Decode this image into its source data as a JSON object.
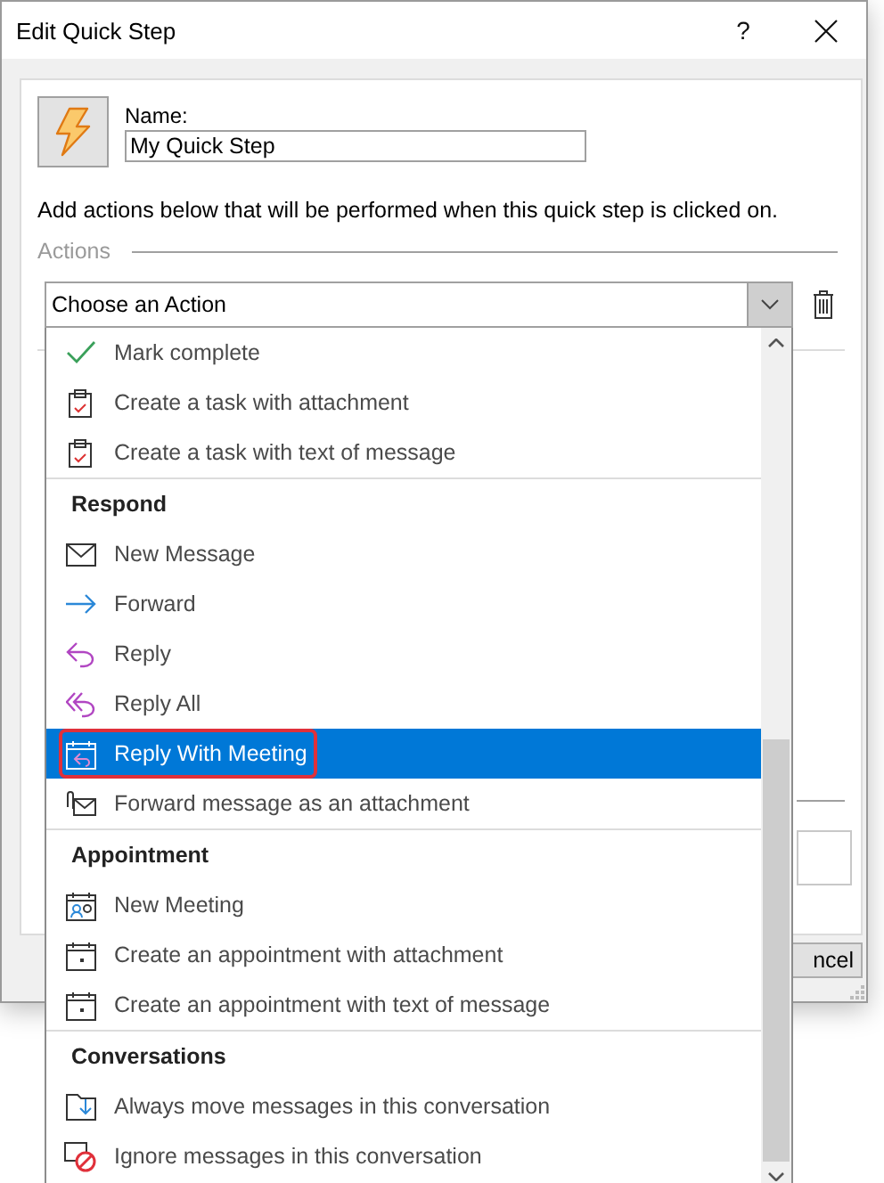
{
  "window": {
    "title": "Edit Quick Step",
    "help": "?"
  },
  "name_field": {
    "label": "Name:",
    "value": "My Quick Step"
  },
  "description": "Add actions below that will be performed when this quick step is clicked on.",
  "actions_heading": "Actions",
  "action_select": {
    "value": "Choose an Action",
    "expanded": true
  },
  "cancel_button": "ncel",
  "menu": {
    "groups": [
      {
        "items": [
          {
            "label": "Mark complete",
            "kind": "check",
            "selected": false
          },
          {
            "label": "Create a task with attachment",
            "kind": "task",
            "selected": false
          },
          {
            "label": "Create a task with text of message",
            "kind": "task",
            "selected": false
          }
        ]
      },
      {
        "heading": "Respond",
        "items": [
          {
            "label": "New Message",
            "kind": "mail",
            "selected": false
          },
          {
            "label": "Forward",
            "kind": "forward",
            "selected": false
          },
          {
            "label": "Reply",
            "kind": "reply",
            "selected": false
          },
          {
            "label": "Reply All",
            "kind": "reply-all",
            "selected": false
          },
          {
            "label": "Reply With Meeting",
            "kind": "meeting-reply",
            "selected": true
          },
          {
            "label": "Forward message as an attachment",
            "kind": "attach",
            "selected": false
          }
        ]
      },
      {
        "heading": "Appointment",
        "items": [
          {
            "label": "New Meeting",
            "kind": "meeting",
            "selected": false
          },
          {
            "label": "Create an appointment with attachment",
            "kind": "appointment",
            "selected": false
          },
          {
            "label": "Create an appointment with text of message",
            "kind": "appointment",
            "selected": false
          }
        ]
      },
      {
        "heading": "Conversations",
        "items": [
          {
            "label": "Always move messages in this conversation",
            "kind": "move",
            "selected": false
          },
          {
            "label": "Ignore messages in this conversation",
            "kind": "ignore",
            "selected": false
          }
        ]
      }
    ]
  }
}
